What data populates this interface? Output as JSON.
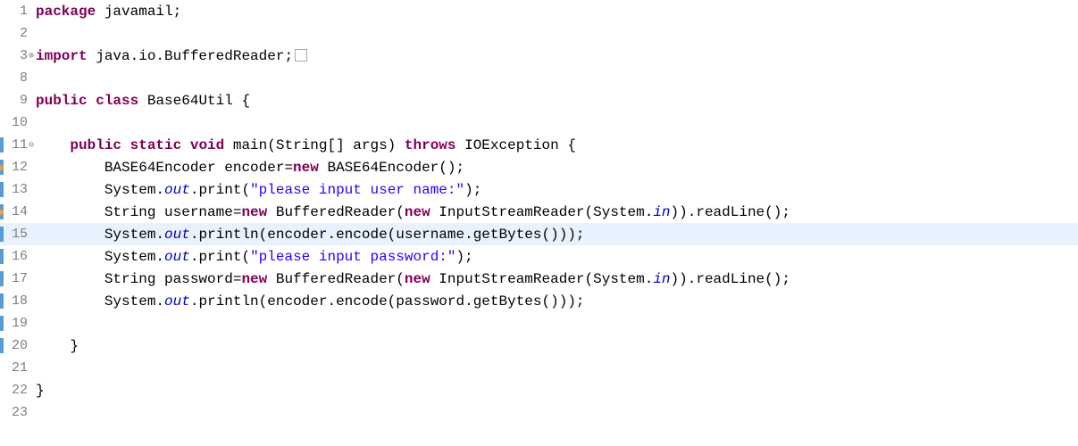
{
  "lines": [
    {
      "num": 1,
      "marker": "",
      "fold": "",
      "warn": false,
      "highlighted": false
    },
    {
      "num": 2,
      "marker": "",
      "fold": "",
      "warn": false,
      "highlighted": false
    },
    {
      "num": 3,
      "marker": "",
      "fold": "plus",
      "warn": false,
      "highlighted": false
    },
    {
      "num": 8,
      "marker": "",
      "fold": "",
      "warn": false,
      "highlighted": false
    },
    {
      "num": 9,
      "marker": "",
      "fold": "",
      "warn": false,
      "highlighted": false
    },
    {
      "num": 10,
      "marker": "",
      "fold": "",
      "warn": false,
      "highlighted": false
    },
    {
      "num": 11,
      "marker": "blue",
      "fold": "minus",
      "warn": false,
      "highlighted": false
    },
    {
      "num": 12,
      "marker": "blue",
      "fold": "",
      "warn": true,
      "highlighted": false
    },
    {
      "num": 13,
      "marker": "blue",
      "fold": "",
      "warn": false,
      "highlighted": false
    },
    {
      "num": 14,
      "marker": "blue",
      "fold": "",
      "warn": true,
      "highlighted": false
    },
    {
      "num": 15,
      "marker": "blue",
      "fold": "",
      "warn": false,
      "highlighted": true
    },
    {
      "num": 16,
      "marker": "blue",
      "fold": "",
      "warn": false,
      "highlighted": false
    },
    {
      "num": 17,
      "marker": "blue",
      "fold": "",
      "warn": false,
      "highlighted": false
    },
    {
      "num": 18,
      "marker": "blue",
      "fold": "",
      "warn": false,
      "highlighted": false
    },
    {
      "num": 19,
      "marker": "blue",
      "fold": "",
      "warn": false,
      "highlighted": false
    },
    {
      "num": 20,
      "marker": "blue",
      "fold": "",
      "warn": false,
      "highlighted": false
    },
    {
      "num": 21,
      "marker": "",
      "fold": "",
      "warn": false,
      "highlighted": false
    },
    {
      "num": 22,
      "marker": "",
      "fold": "",
      "warn": false,
      "highlighted": false
    },
    {
      "num": 23,
      "marker": "",
      "fold": "",
      "warn": false,
      "highlighted": false
    }
  ],
  "tokens": {
    "l1": {
      "kw_package": "package",
      "t1": " javamail;"
    },
    "l3": {
      "kw_import": "import",
      "t1": " java.io.BufferedReader;"
    },
    "l9": {
      "kw_public": "public",
      "kw_class": "class",
      "t1": " Base64Util {"
    },
    "l11": {
      "indent": "    ",
      "kw_public": "public",
      "kw_static": "static",
      "kw_void": "void",
      "t1": " main(String[] args) ",
      "kw_throws": "throws",
      "t2": " IOException {"
    },
    "l12": {
      "indent": "        ",
      "t1": "BASE64Encoder encoder=",
      "kw_new": "new",
      "t2": " BASE64Encoder();"
    },
    "l13": {
      "indent": "        ",
      "t1": "System.",
      "field_out": "out",
      "t2": ".print(",
      "str": "\"please input user name:\"",
      "t3": ");"
    },
    "l14": {
      "indent": "        ",
      "t1": "String username=",
      "kw_new1": "new",
      "t2": " BufferedReader(",
      "kw_new2": "new",
      "t3": " InputStreamReader(System.",
      "field_in": "in",
      "t4": ")).readLine();"
    },
    "l15": {
      "indent": "        ",
      "t1": "System.",
      "field_out": "out",
      "t2": ".println(encoder.encode(username.getBytes()));"
    },
    "l16": {
      "indent": "        ",
      "t1": "System.",
      "field_out": "out",
      "t2": ".print(",
      "str": "\"please input password:\"",
      "t3": ");"
    },
    "l17": {
      "indent": "        ",
      "t1": "String password=",
      "kw_new1": "new",
      "t2": " BufferedReader(",
      "kw_new2": "new",
      "t3": " InputStreamReader(System.",
      "field_in": "in",
      "t4": ")).readLine();"
    },
    "l18": {
      "indent": "        ",
      "t1": "System.",
      "field_out": "out",
      "t2": ".println(encoder.encode(password.getBytes()));"
    },
    "l20": {
      "indent": "    ",
      "t1": "}"
    },
    "l22": {
      "t1": "}"
    }
  }
}
